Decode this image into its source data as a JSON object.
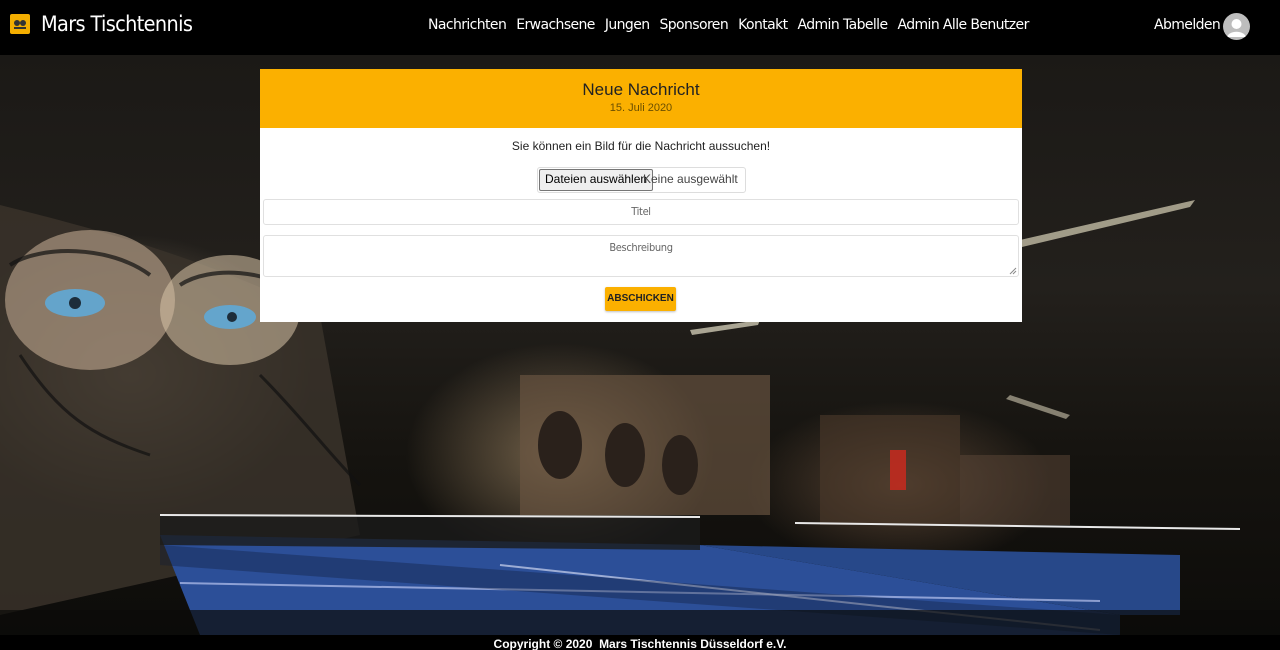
{
  "navbar": {
    "brand": "Mars Tischtennis",
    "logo_icon": "club-logo-icon",
    "links": [
      "Nachrichten",
      "Erwachsene",
      "Jungen",
      "Sponsoren",
      "Kontakt",
      "Admin Tabelle",
      "Admin Alle Benutzer"
    ],
    "logout": "Abmelden",
    "avatar_icon": "user-avatar-icon"
  },
  "card": {
    "title": "Neue Nachricht",
    "date": "15. Juli 2020",
    "hint": "Sie können ein Bild für die Nachricht aussuchen!",
    "file_button": "Dateien auswählen",
    "file_status": "Keine ausgewählt",
    "title_placeholder": "Titel",
    "description_placeholder": "Beschreibung",
    "submit": "ABSCHICKEN"
  },
  "footer": {
    "text": "Copyright © 2020  Mars Tischtennis Düsseldorf e.V."
  },
  "colors": {
    "accent": "#fbb000",
    "navbar": "#000000",
    "card": "#ffffff"
  }
}
